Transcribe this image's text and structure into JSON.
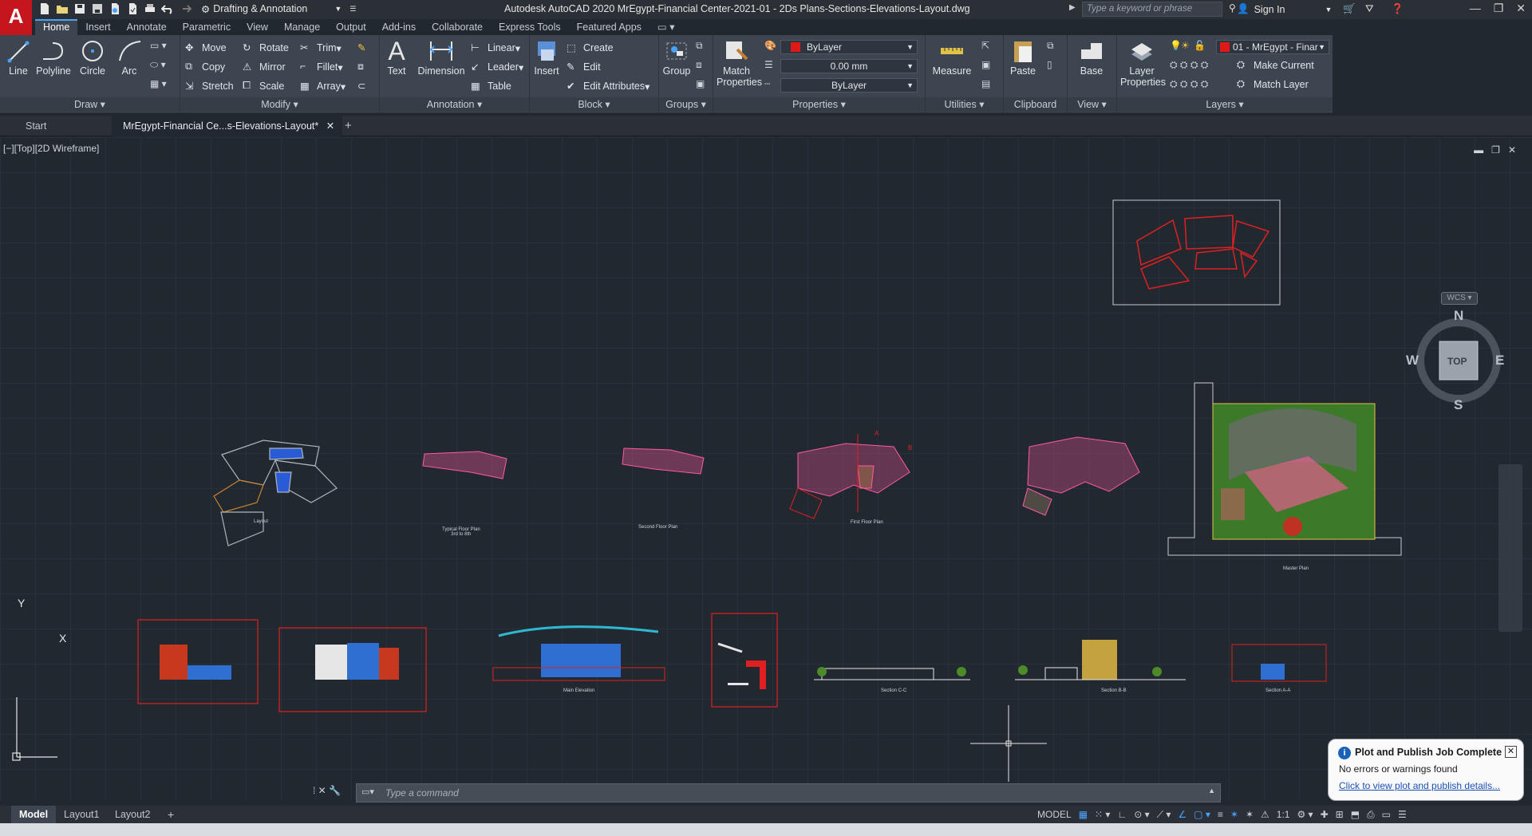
{
  "app": {
    "logo": "A",
    "window_title": "Autodesk AutoCAD 2020   MrEgypt-Financial Center-2021-01 - 2Ds Plans-Sections-Elevations-Layout.dwg",
    "workspace": "Drafting & Annotation",
    "search_placeholder": "Type a keyword or phrase",
    "sign_in": "Sign In"
  },
  "menu": [
    "Home",
    "Insert",
    "Annotate",
    "Parametric",
    "View",
    "Manage",
    "Output",
    "Add-ins",
    "Collaborate",
    "Express Tools",
    "Featured Apps"
  ],
  "ribbon": {
    "draw": {
      "title": "Draw",
      "line": "Line",
      "polyline": "Polyline",
      "circle": "Circle",
      "arc": "Arc"
    },
    "modify": {
      "title": "Modify",
      "move": "Move",
      "rotate": "Rotate",
      "trim": "Trim",
      "copy": "Copy",
      "mirror": "Mirror",
      "fillet": "Fillet",
      "stretch": "Stretch",
      "scale": "Scale",
      "array": "Array"
    },
    "annotation": {
      "title": "Annotation",
      "text": "Text",
      "dimension": "Dimension",
      "linear": "Linear",
      "leader": "Leader",
      "table": "Table"
    },
    "block": {
      "title": "Block",
      "insert": "Insert",
      "create": "Create",
      "edit": "Edit",
      "edit_attributes": "Edit Attributes"
    },
    "groups": {
      "title": "Groups",
      "group": "Group"
    },
    "properties": {
      "title": "Properties",
      "match": "Match Properties",
      "color": "ByLayer",
      "lineweight": "0.00 mm",
      "linetype": "ByLayer"
    },
    "utilities": {
      "title": "Utilities",
      "measure": "Measure"
    },
    "clipboard": {
      "title": "Clipboard",
      "paste": "Paste"
    },
    "view": {
      "title": "View",
      "base": "Base"
    },
    "layers": {
      "title": "Layers",
      "layer_properties": "Layer Properties",
      "current_layer": "01 - MrEgypt - Finar",
      "make_current": "Make Current",
      "match_layer": "Match Layer"
    }
  },
  "doc_tabs": {
    "start": "Start",
    "active": "MrEgypt-Financial Ce...s-Elevations-Layout*"
  },
  "viewport": {
    "label": "[−][Top][2D Wireframe]",
    "compass": {
      "n": "N",
      "s": "S",
      "e": "E",
      "w": "W",
      "top": "TOP",
      "wcs": "WCS"
    },
    "ucs_y": "Y",
    "ucs_x": "X"
  },
  "drawings": {
    "layout": "Layout",
    "typical": "Typical Floor Plan",
    "typical_sub": "3rd to 8th",
    "second": "Second Floor Plan",
    "first": "First Floor Plan",
    "master": "Master Plan",
    "main_elev": "Main Elevation",
    "sec_c": "Section C-C",
    "sec_b": "Section B-B",
    "sec_a": "Section A-A",
    "mark_a": "A",
    "mark_b": "B"
  },
  "command": {
    "placeholder": "Type  a  command"
  },
  "layout_tabs": [
    "Model",
    "Layout1",
    "Layout2"
  ],
  "status": {
    "model": "MODEL",
    "scale": "1:1"
  },
  "notification": {
    "title": "Plot and Publish Job Complete",
    "body": "No errors or warnings found",
    "link": "Click to view plot and publish details..."
  },
  "colors": {
    "accent": "#4aa3ff",
    "logo": "#c4161c",
    "bg": "#212830",
    "ribbon": "#3d4550"
  }
}
